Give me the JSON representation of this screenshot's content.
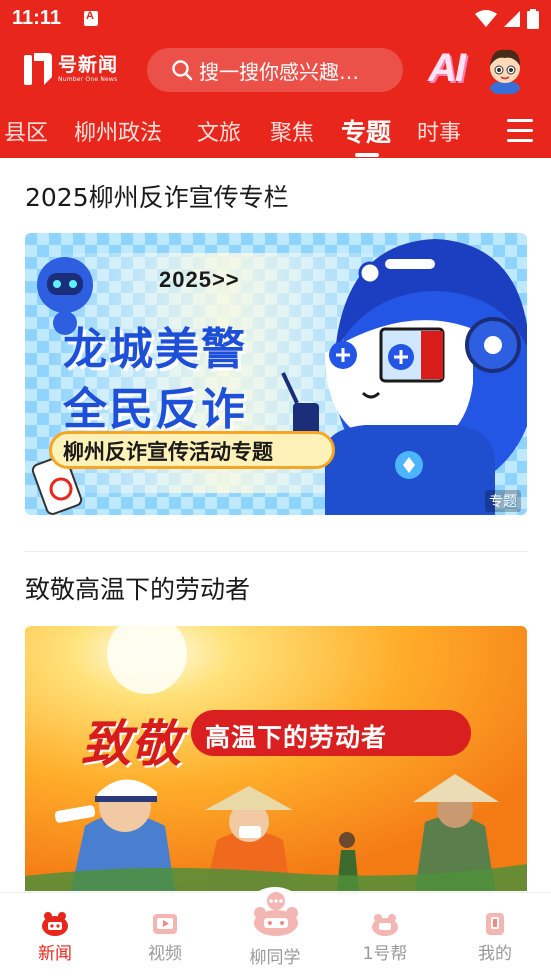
{
  "status_bar": {
    "time": "11:11"
  },
  "header": {
    "logo": {
      "title": "号新闻",
      "subtitle": "Number One News"
    },
    "search": {
      "placeholder": "搜一搜你感兴趣…"
    },
    "ai_label": "AI"
  },
  "tabs": [
    {
      "label": "县区",
      "active": false
    },
    {
      "label": "柳州政法",
      "active": false
    },
    {
      "label": "文旅",
      "active": false
    },
    {
      "label": "聚焦",
      "active": false
    },
    {
      "label": "专题",
      "active": true
    },
    {
      "label": "时事",
      "active": false
    }
  ],
  "articles": [
    {
      "title": "2025柳州反诈宣传专栏",
      "banner": {
        "year": "2025>>",
        "line1": "龙城美警",
        "line2": "全民反诈",
        "subtitle": "柳州反诈宣传活动专题",
        "tag": "专题"
      }
    },
    {
      "title": "致敬高温下的劳动者",
      "banner": {
        "headline_left": "致敬",
        "headline_right": "高温下的劳动者"
      }
    }
  ],
  "bottom_nav": [
    {
      "label": "新闻",
      "icon": "news-icon",
      "active": true
    },
    {
      "label": "视频",
      "icon": "video-icon",
      "active": false
    },
    {
      "label": "柳同学",
      "icon": "assistant-icon",
      "active": false
    },
    {
      "label": "1号帮",
      "icon": "help-icon",
      "active": false
    },
    {
      "label": "我的",
      "icon": "profile-icon",
      "active": false
    }
  ],
  "colors": {
    "brand_red": "#e8261c",
    "inactive_gray": "#999999"
  }
}
